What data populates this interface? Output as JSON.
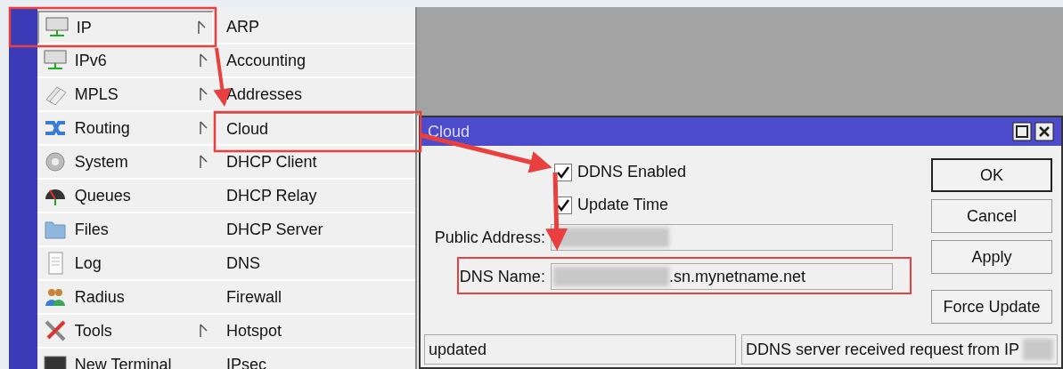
{
  "menu": {
    "items": [
      {
        "label": "IP",
        "submenu": true,
        "selected": true
      },
      {
        "label": "IPv6",
        "submenu": true,
        "selected": false
      },
      {
        "label": "MPLS",
        "submenu": true,
        "selected": false
      },
      {
        "label": "Routing",
        "submenu": true,
        "selected": false
      },
      {
        "label": "System",
        "submenu": true,
        "selected": false
      },
      {
        "label": "Queues",
        "submenu": false,
        "selected": false
      },
      {
        "label": "Files",
        "submenu": false,
        "selected": false
      },
      {
        "label": "Log",
        "submenu": false,
        "selected": false
      },
      {
        "label": "Radius",
        "submenu": false,
        "selected": false
      },
      {
        "label": "Tools",
        "submenu": true,
        "selected": false
      },
      {
        "label": "New Terminal",
        "submenu": false,
        "selected": false
      }
    ]
  },
  "submenu": {
    "items": [
      {
        "label": "ARP",
        "selected": false
      },
      {
        "label": "Accounting",
        "selected": false
      },
      {
        "label": "Addresses",
        "selected": false
      },
      {
        "label": "Cloud",
        "selected": true
      },
      {
        "label": "DHCP Client",
        "selected": false
      },
      {
        "label": "DHCP Relay",
        "selected": false
      },
      {
        "label": "DHCP Server",
        "selected": false
      },
      {
        "label": "DNS",
        "selected": false
      },
      {
        "label": "Firewall",
        "selected": false
      },
      {
        "label": "Hotspot",
        "selected": false
      },
      {
        "label": "IPsec",
        "selected": false
      }
    ]
  },
  "dialog": {
    "title": "Cloud",
    "checkboxes": [
      {
        "label": "DDNS Enabled",
        "checked": true
      },
      {
        "label": "Update Time",
        "checked": true
      }
    ],
    "fields": [
      {
        "label": "Public Address:",
        "redacted": true
      },
      {
        "label": "DNS Name:",
        "redacted": true,
        "value": ".sn.mynetname.net"
      }
    ],
    "buttons": [
      {
        "label": "OK",
        "default": true
      },
      {
        "label": "Cancel",
        "default": false
      },
      {
        "label": "Apply",
        "default": false
      },
      {
        "label": "Force Update",
        "default": false
      }
    ],
    "status_bar": [
      {
        "text": "updated",
        "redacted": false
      },
      {
        "text": "DDNS server received request from IP",
        "redacted": true
      }
    ]
  }
}
